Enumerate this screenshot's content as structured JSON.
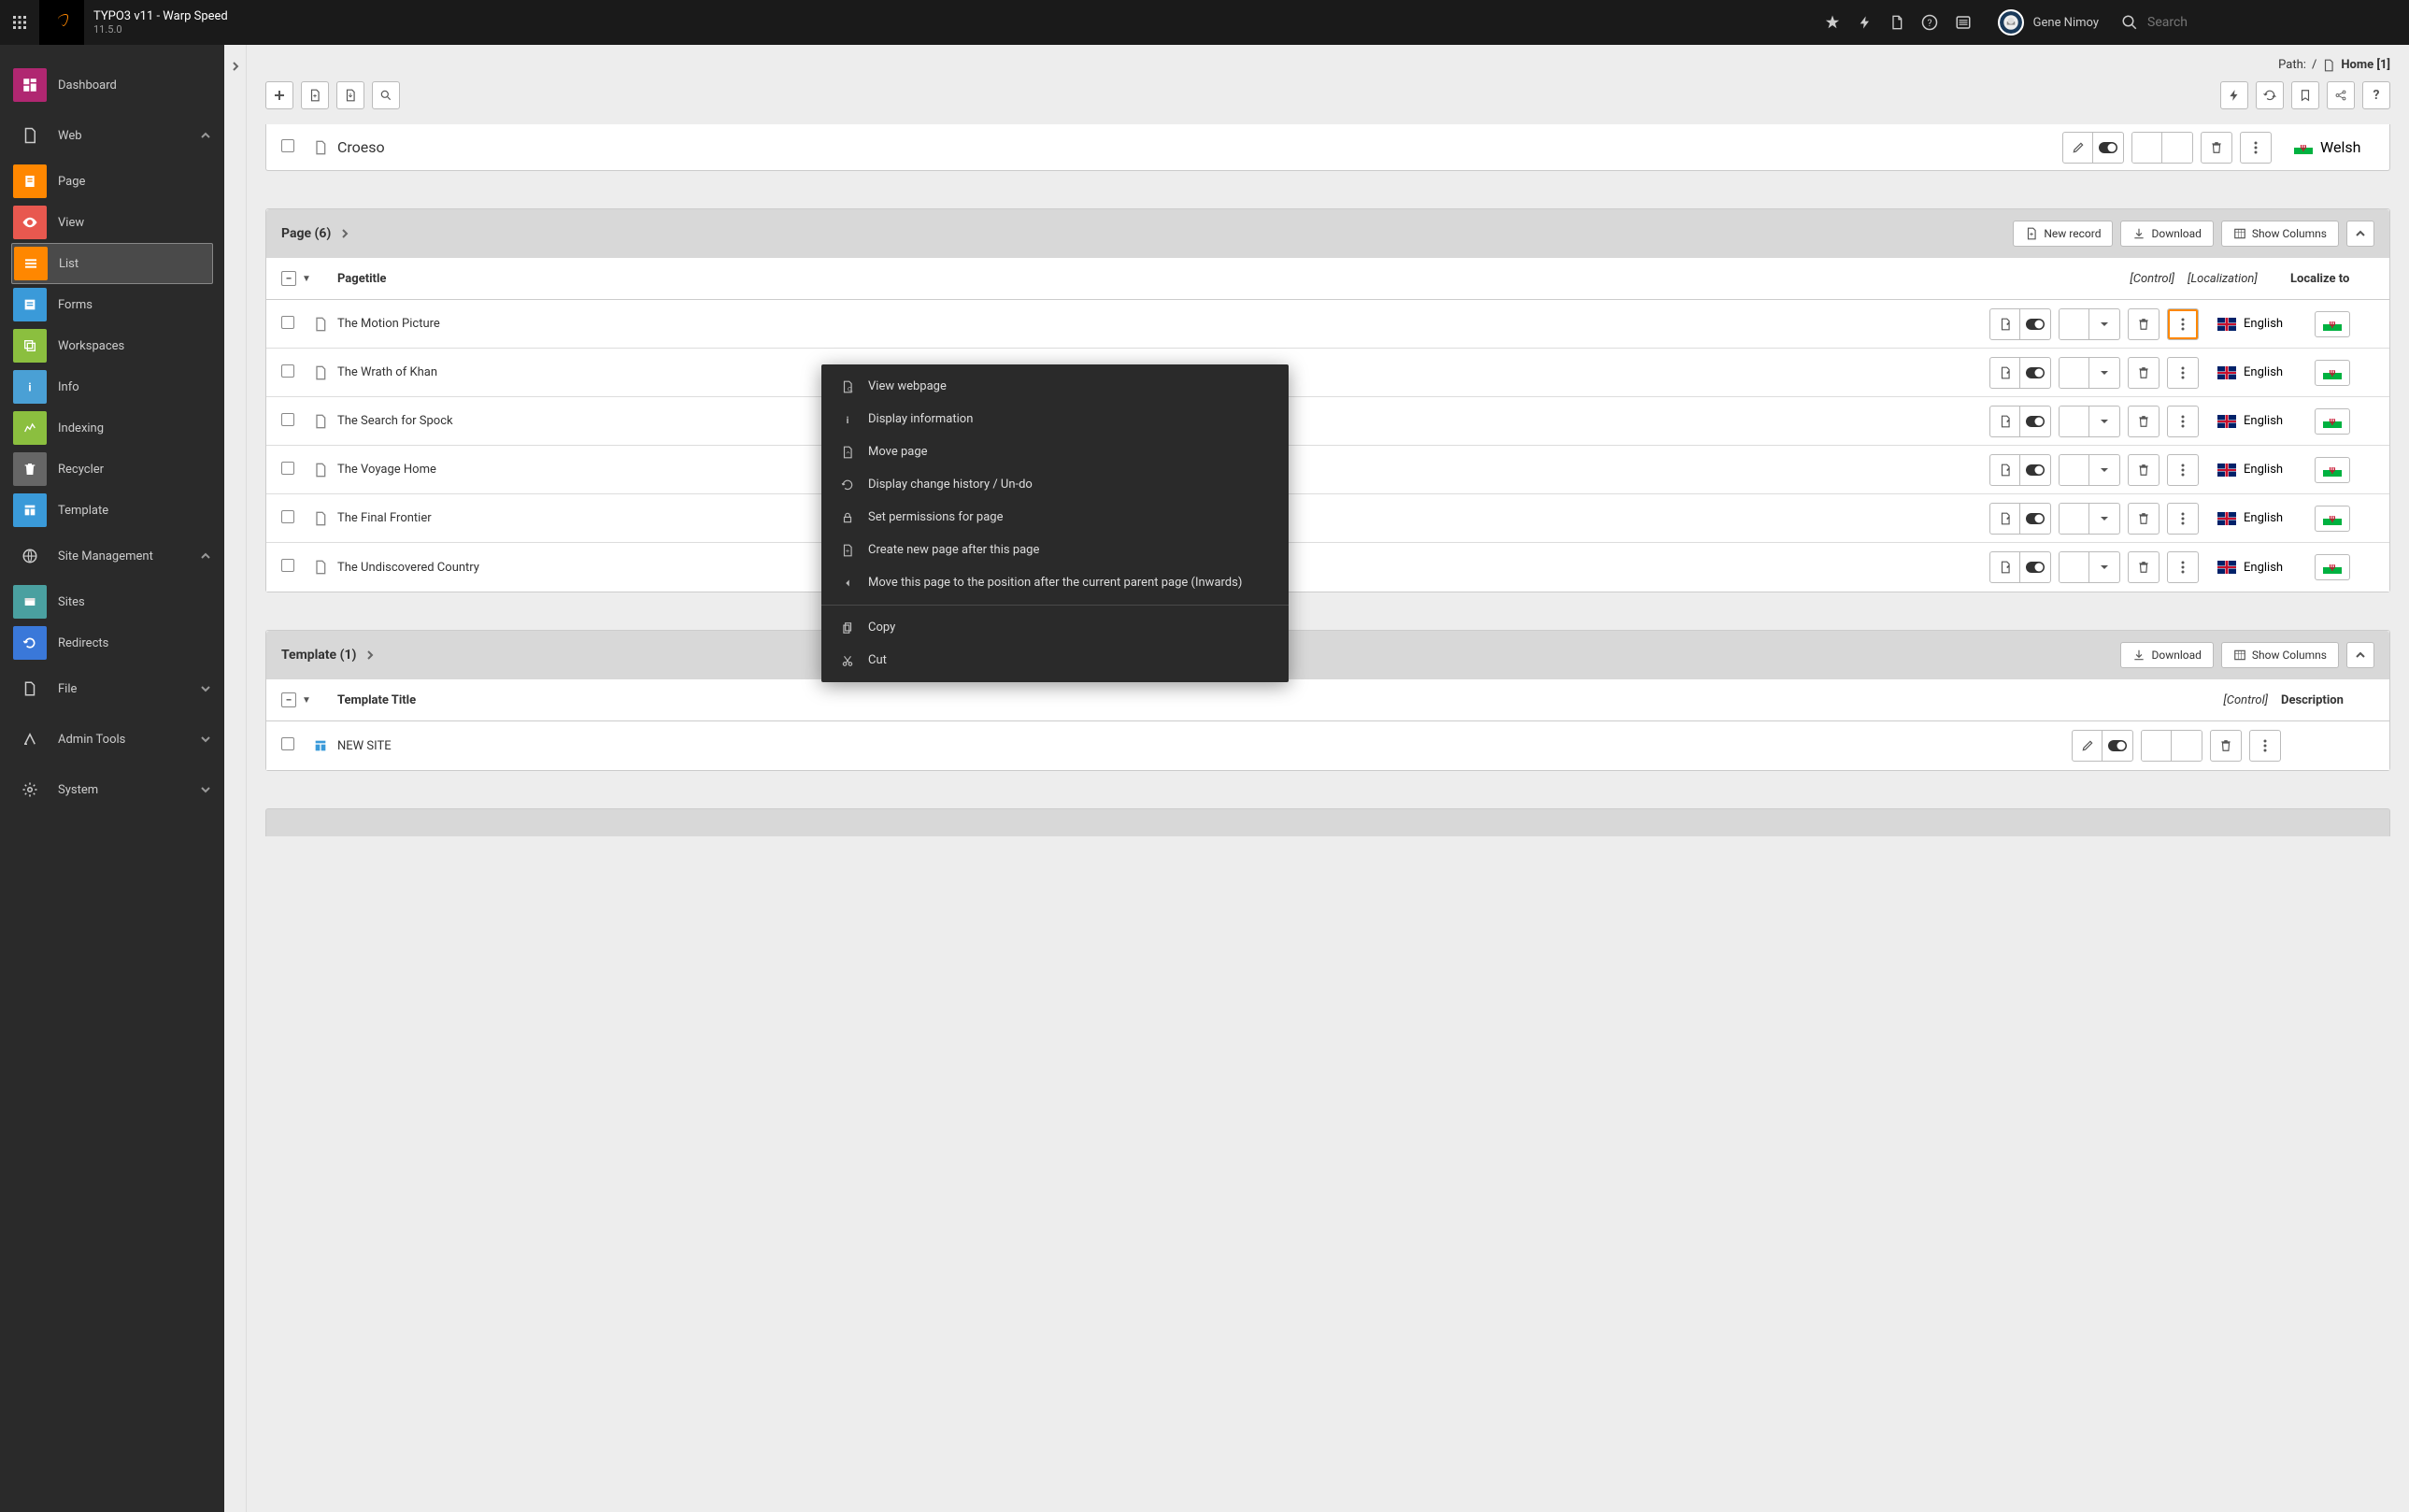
{
  "topbar": {
    "title": "TYPO3 v11 - Warp Speed",
    "version": "11.5.0",
    "user": "Gene Nimoy",
    "search_placeholder": "Search"
  },
  "modulemenu": {
    "groups": [
      {
        "key": "dashboard",
        "label": "Dashboard",
        "color": "#b02771",
        "type": "single"
      },
      {
        "key": "web",
        "label": "Web",
        "type": "group",
        "expanded": true,
        "items": [
          {
            "key": "page",
            "label": "Page",
            "color": "#ff8700"
          },
          {
            "key": "view",
            "label": "View",
            "color": "#e8584f"
          },
          {
            "key": "list",
            "label": "List",
            "color": "#ff8700",
            "active": true
          },
          {
            "key": "forms",
            "label": "Forms",
            "color": "#3a9ad9"
          },
          {
            "key": "workspaces",
            "label": "Workspaces",
            "color": "#8bbf3f"
          },
          {
            "key": "info",
            "label": "Info",
            "color": "#4aa0d5"
          },
          {
            "key": "indexing",
            "label": "Indexing",
            "color": "#8bbf3f"
          },
          {
            "key": "recycler",
            "label": "Recycler",
            "color": "#666666"
          },
          {
            "key": "template",
            "label": "Template",
            "color": "#3a9ad9"
          }
        ]
      },
      {
        "key": "site",
        "label": "Site Management",
        "type": "group",
        "expanded": true,
        "items": [
          {
            "key": "sites",
            "label": "Sites",
            "color": "#4aa0a0"
          },
          {
            "key": "redirects",
            "label": "Redirects",
            "color": "#3a78d9"
          }
        ]
      },
      {
        "key": "file",
        "label": "File",
        "type": "group",
        "expanded": false
      },
      {
        "key": "admin",
        "label": "Admin Tools",
        "type": "group",
        "expanded": false
      },
      {
        "key": "system",
        "label": "System",
        "type": "group",
        "expanded": false
      }
    ]
  },
  "docheader": {
    "path_label": "Path:",
    "path_sep": "/",
    "path_page": "Home [1]"
  },
  "partial_row": {
    "title": "Croeso",
    "lang": "Welsh"
  },
  "page_panel": {
    "title": "Page (6)",
    "new_record": "New record",
    "download": "Download",
    "show_columns": "Show Columns",
    "columns": {
      "pagetitle": "Pagetitle",
      "control": "[Control]",
      "localization": "[Localization]",
      "localize_to": "Localize to"
    },
    "rows": [
      {
        "title": "The Motion Picture",
        "lang": "English",
        "menu_open": true
      },
      {
        "title": "The Wrath of Khan",
        "lang": "English"
      },
      {
        "title": "The Search for Spock",
        "lang": "English"
      },
      {
        "title": "The Voyage Home",
        "lang": "English"
      },
      {
        "title": "The Final Frontier",
        "lang": "English"
      },
      {
        "title": "The Undiscovered Country",
        "lang": "English"
      }
    ]
  },
  "template_panel": {
    "title": "Template (1)",
    "download": "Download",
    "show_columns": "Show Columns",
    "columns": {
      "template_title": "Template Title",
      "control": "[Control]",
      "description": "Description"
    },
    "rows": [
      {
        "title": "NEW SITE"
      }
    ]
  },
  "context_menu": {
    "items1": [
      {
        "icon": "view",
        "label": "View webpage"
      },
      {
        "icon": "info",
        "label": "Display information"
      },
      {
        "icon": "move",
        "label": "Move page"
      },
      {
        "icon": "history",
        "label": "Display change history / Un-do"
      },
      {
        "icon": "lock",
        "label": "Set permissions for page"
      },
      {
        "icon": "create",
        "label": "Create new page after this page"
      },
      {
        "icon": "inward",
        "label": "Move this page to the position after the current parent page (Inwards)"
      }
    ],
    "items2": [
      {
        "icon": "copy",
        "label": "Copy"
      },
      {
        "icon": "cut",
        "label": "Cut"
      }
    ]
  }
}
